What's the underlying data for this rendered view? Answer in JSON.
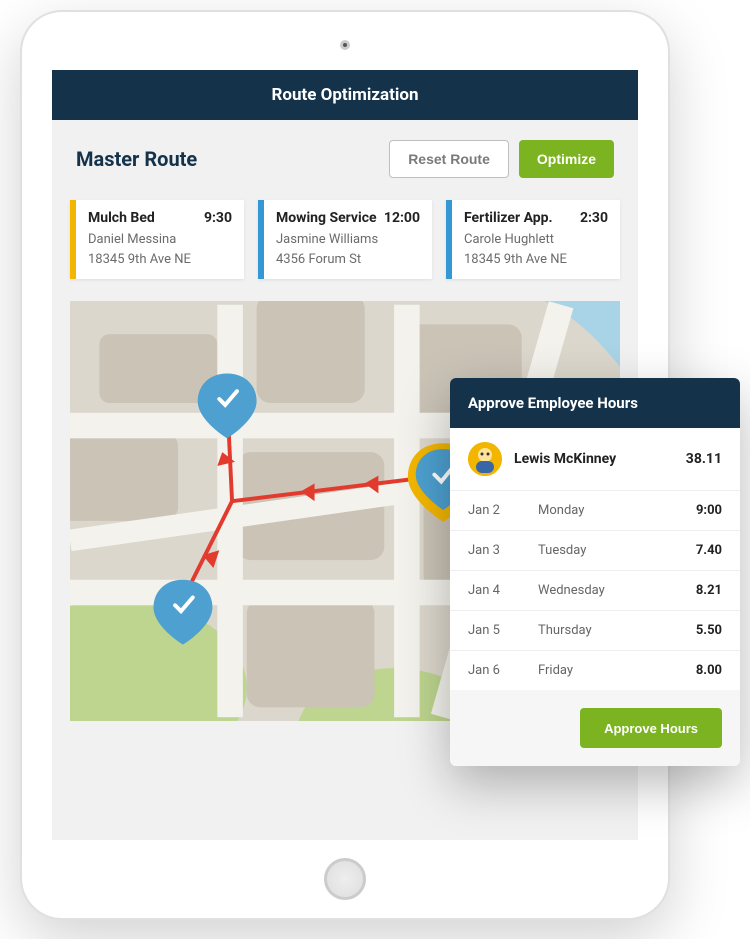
{
  "header": {
    "title": "Route Optimization"
  },
  "toolbar": {
    "section_title": "Master Route",
    "reset_label": "Reset Route",
    "optimize_label": "Optimize"
  },
  "jobs": [
    {
      "title": "Mulch Bed",
      "time": "9:30",
      "client": "Daniel Messina",
      "address": "18345 9th Ave NE",
      "accent": "yellow"
    },
    {
      "title": "Mowing Service",
      "time": "12:00",
      "client": "Jasmine Williams",
      "address": "4356 Forum St",
      "accent": "blue"
    },
    {
      "title": "Fertilizer App.",
      "time": "2:30",
      "client": "Carole Hughlett",
      "address": "18345 9th Ave NE",
      "accent": "blue"
    }
  ],
  "hours_card": {
    "title": "Approve Employee Hours",
    "employee_name": "Lewis McKinney",
    "total": "38.11",
    "rows": [
      {
        "date": "Jan 2",
        "day": "Monday",
        "hours": "9:00"
      },
      {
        "date": "Jan 3",
        "day": "Tuesday",
        "hours": "7.40"
      },
      {
        "date": "Jan 4",
        "day": "Wednesday",
        "hours": "8.21"
      },
      {
        "date": "Jan 5",
        "day": "Thursday",
        "hours": "5.50"
      },
      {
        "date": "Jan 6",
        "day": "Friday",
        "hours": "8.00"
      }
    ],
    "approve_label": "Approve Hours"
  }
}
